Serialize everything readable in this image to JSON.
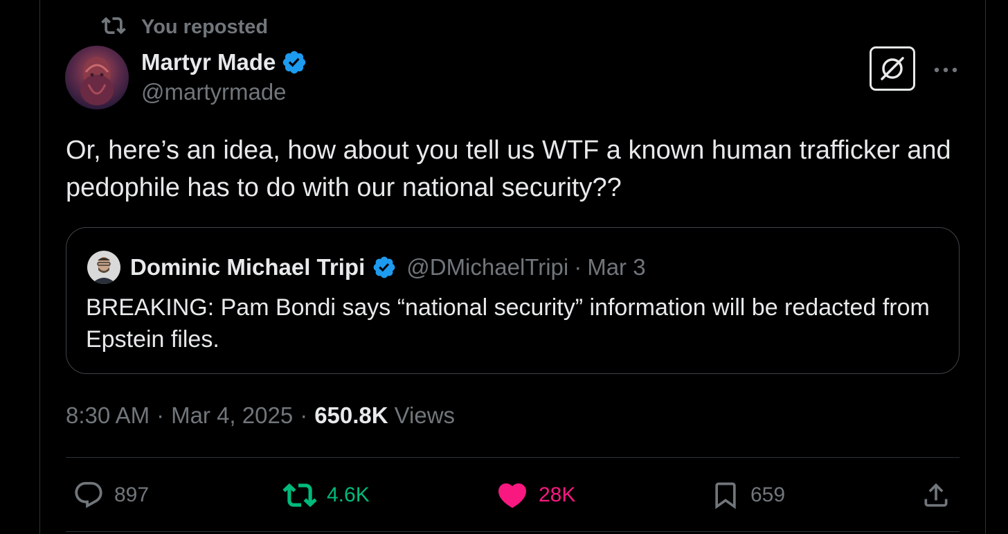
{
  "repost": {
    "label": "You reposted",
    "icon": "repost-icon"
  },
  "author": {
    "display_name": "Martyr Made",
    "handle": "@martyrmade",
    "verified": true,
    "badge_color": "#1d9bf0"
  },
  "tweet": {
    "text": "Or, here’s an idea, how about you tell us WTF a known human trafficker and pedophile has to do with our national security??"
  },
  "quote": {
    "display_name": "Dominic Michael Tripi",
    "handle": "@DMichaelTripi",
    "separator": "·",
    "date": "Mar 3",
    "text": "BREAKING: Pam Bondi says “national security” information will be redacted from Epstein files."
  },
  "meta": {
    "time": "8:30 AM",
    "separator": "·",
    "date": "Mar 4, 2025",
    "views_count": "650.8K",
    "views_label": "Views"
  },
  "actions": {
    "replies": "897",
    "reposts": "4.6K",
    "likes": "28K",
    "bookmarks": "659"
  },
  "colors": {
    "background": "#000000",
    "text": "#e7e9ea",
    "muted": "#71767b",
    "repost_active": "#00ba7c",
    "like_active": "#f91880",
    "verified": "#1d9bf0"
  },
  "icons": {
    "top_right": [
      "grok-icon",
      "more-icon"
    ],
    "actions": [
      "reply-icon",
      "retweet-icon",
      "heart-icon",
      "bookmark-icon",
      "share-icon"
    ]
  }
}
